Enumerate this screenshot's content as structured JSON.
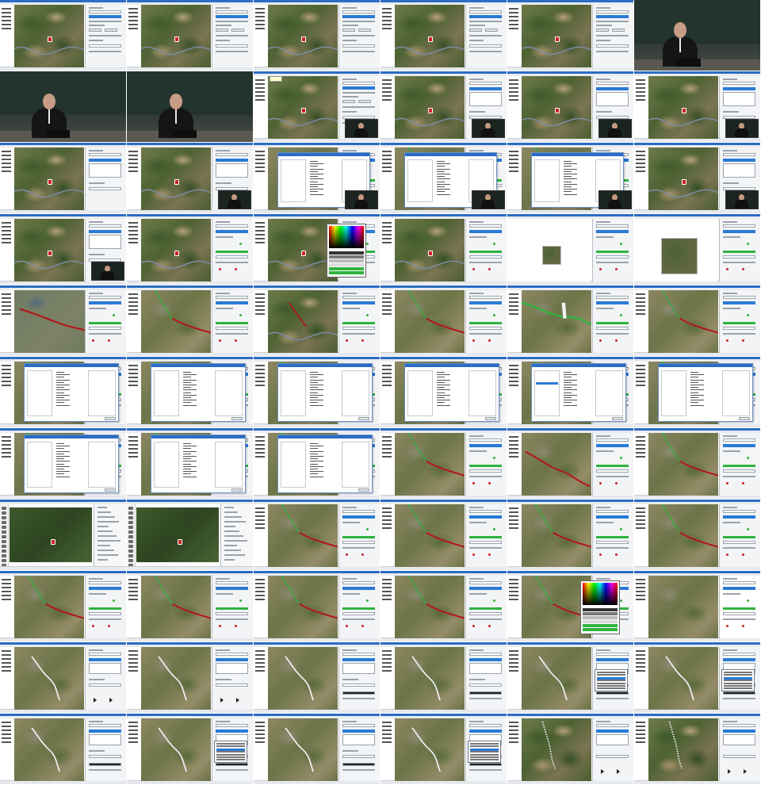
{
  "page": {
    "title": "",
    "description_items": []
  },
  "colors": {
    "window_title": "#2b6cc4",
    "selection": "#2a7ad6",
    "status_green": "#2fb33f",
    "route_red": "#b3161a",
    "route_green": "#2fb33f",
    "route_white": "#f0f0f0"
  },
  "thumbnails": [
    {
      "kind": "app",
      "map": "normal",
      "panel": "A",
      "marker": true
    },
    {
      "kind": "app",
      "map": "normal",
      "panel": "A",
      "marker": true
    },
    {
      "kind": "app",
      "map": "normal",
      "panel": "A",
      "marker": true
    },
    {
      "kind": "app",
      "map": "normal",
      "panel": "A",
      "marker": true
    },
    {
      "kind": "app",
      "map": "normal",
      "panel": "A",
      "marker": true
    },
    {
      "kind": "speaker",
      "variant": "right"
    },
    {
      "kind": "speaker",
      "variant": "left"
    },
    {
      "kind": "speaker",
      "variant": "center"
    },
    {
      "kind": "app",
      "map": "normal",
      "panel": "A",
      "marker": true,
      "tooltip": true,
      "webcam": true
    },
    {
      "kind": "app",
      "map": "normal",
      "panel": "B",
      "marker": true,
      "webcam": true
    },
    {
      "kind": "app",
      "map": "normal",
      "panel": "B",
      "marker": true,
      "webcam": true
    },
    {
      "kind": "app",
      "map": "normal",
      "panel": "B",
      "marker": true,
      "webcam": true
    },
    {
      "kind": "app",
      "map": "normal",
      "panel": "B",
      "marker": true
    },
    {
      "kind": "app",
      "map": "normal",
      "panel": "B",
      "marker": true,
      "webcam": true
    },
    {
      "kind": "dialog",
      "webcam": true
    },
    {
      "kind": "dialog",
      "webcam": true
    },
    {
      "kind": "dialog",
      "webcam": true
    },
    {
      "kind": "app",
      "map": "normal",
      "panel": "B",
      "marker": true,
      "webcam": true
    },
    {
      "kind": "app",
      "map": "normal",
      "panel": "B",
      "marker": true,
      "webcam": true
    },
    {
      "kind": "app",
      "map": "normal",
      "panel": "C",
      "marker": true
    },
    {
      "kind": "app",
      "map": "normal",
      "panel": "C",
      "marker": true,
      "colorpicker": true
    },
    {
      "kind": "app",
      "map": "normal",
      "panel": "C",
      "marker": true
    },
    {
      "kind": "blank",
      "mini": "small"
    },
    {
      "kind": "blank",
      "mini": "large"
    },
    {
      "kind": "app",
      "map": "lake",
      "panel": "C",
      "route": "red",
      "wide": true
    },
    {
      "kind": "app",
      "map": "urban",
      "panel": "C",
      "route": "green-red"
    },
    {
      "kind": "app",
      "map": "normal",
      "panel": "C",
      "route": "red-dark"
    },
    {
      "kind": "app",
      "map": "urban",
      "panel": "C",
      "route": "green-red"
    },
    {
      "kind": "app",
      "map": "urban",
      "panel": "C",
      "route": "white-bold"
    },
    {
      "kind": "app",
      "map": "urban",
      "panel": "C",
      "route": "green-red"
    },
    {
      "kind": "dialog2"
    },
    {
      "kind": "dialog2"
    },
    {
      "kind": "dialog2"
    },
    {
      "kind": "dialog2"
    },
    {
      "kind": "dialog2",
      "listsel": true
    },
    {
      "kind": "dialog2"
    },
    {
      "kind": "dialog2"
    },
    {
      "kind": "dialog2"
    },
    {
      "kind": "dialog2"
    },
    {
      "kind": "app",
      "map": "urban",
      "panel": "C",
      "route": "green-red"
    },
    {
      "kind": "app",
      "map": "urban",
      "panel": "C",
      "route": "red"
    },
    {
      "kind": "app",
      "map": "urban",
      "panel": "C",
      "route": "green-red"
    },
    {
      "kind": "editor",
      "map": "dark"
    },
    {
      "kind": "editor",
      "map": "dark"
    },
    {
      "kind": "app",
      "map": "urban",
      "panel": "C",
      "route": "green-red"
    },
    {
      "kind": "app",
      "map": "urban",
      "panel": "C",
      "route": "green-red"
    },
    {
      "kind": "app",
      "map": "urban",
      "panel": "C",
      "route": "green-red"
    },
    {
      "kind": "app",
      "map": "urban",
      "panel": "C",
      "route": "green-red"
    },
    {
      "kind": "app",
      "map": "urban",
      "panel": "C",
      "route": "green-red"
    },
    {
      "kind": "app",
      "map": "urban",
      "panel": "C",
      "route": "green-red"
    },
    {
      "kind": "app",
      "map": "urban",
      "panel": "C",
      "route": "green-red"
    },
    {
      "kind": "app",
      "map": "urban",
      "panel": "C",
      "route": "green-red"
    },
    {
      "kind": "app",
      "map": "urban",
      "panel": "C",
      "route": "green-red",
      "colorpicker": true
    },
    {
      "kind": "app",
      "map": "urban",
      "panel": "D",
      "route": "none",
      "listpanel": true
    },
    {
      "kind": "app",
      "map": "urban",
      "panel": "E",
      "route": "white"
    },
    {
      "kind": "app",
      "map": "urban",
      "panel": "E",
      "route": "white"
    },
    {
      "kind": "app",
      "map": "urban",
      "panel": "F",
      "route": "white"
    },
    {
      "kind": "app",
      "map": "urban",
      "panel": "F",
      "route": "white"
    },
    {
      "kind": "app",
      "map": "urban",
      "panel": "G",
      "route": "white",
      "popup": true
    },
    {
      "kind": "app",
      "map": "urban",
      "panel": "G",
      "route": "white",
      "popup": true
    },
    {
      "kind": "app",
      "map": "urban",
      "panel": "G",
      "route": "white"
    },
    {
      "kind": "app",
      "map": "urban",
      "panel": "G",
      "route": "white",
      "popup": true
    },
    {
      "kind": "app",
      "map": "urban",
      "panel": "G",
      "route": "white"
    },
    {
      "kind": "app",
      "map": "urban",
      "panel": "G",
      "route": "white",
      "popup": true
    },
    {
      "kind": "app",
      "map": "normal",
      "panel": "H",
      "route": "dotted"
    },
    {
      "kind": "app",
      "map": "normal",
      "panel": "H",
      "route": "dotted"
    }
  ]
}
